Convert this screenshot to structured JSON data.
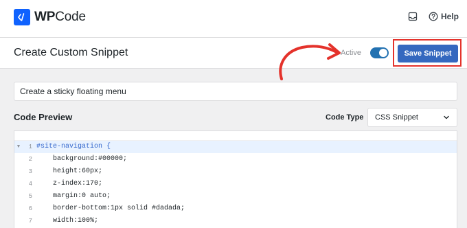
{
  "app": {
    "logo_text_bold": "WP",
    "logo_text_rest": "Code",
    "help_label": "Help"
  },
  "header": {
    "page_title": "Create Custom Snippet",
    "active_label": "Active",
    "active_toggle_on": true,
    "save_label": "Save Snippet"
  },
  "snippet": {
    "title_value": "Create a sticky floating menu"
  },
  "code_preview": {
    "section_title": "Code Preview",
    "code_type_label": "Code Type",
    "code_type_value": "CSS Snippet",
    "lines": [
      {
        "num": "1",
        "text": "#site-navigation {"
      },
      {
        "num": "2",
        "text": "    background:#00000;"
      },
      {
        "num": "3",
        "text": "    height:60px;"
      },
      {
        "num": "4",
        "text": "    z-index:170;"
      },
      {
        "num": "5",
        "text": "    margin:0 auto;"
      },
      {
        "num": "6",
        "text": "    border-bottom:1px solid #dadada;"
      },
      {
        "num": "7",
        "text": "    width:100%;"
      }
    ]
  },
  "colors": {
    "brand": "#0f62fe",
    "primary_button": "#3468bf",
    "toggle_on": "#2271b1",
    "highlight": "#e4322b"
  },
  "icons": [
    "wpcode-logo-icon",
    "inbox-icon",
    "help-circle-icon",
    "chevron-down-icon",
    "fold-arrow-icon",
    "annotation-arrow"
  ]
}
